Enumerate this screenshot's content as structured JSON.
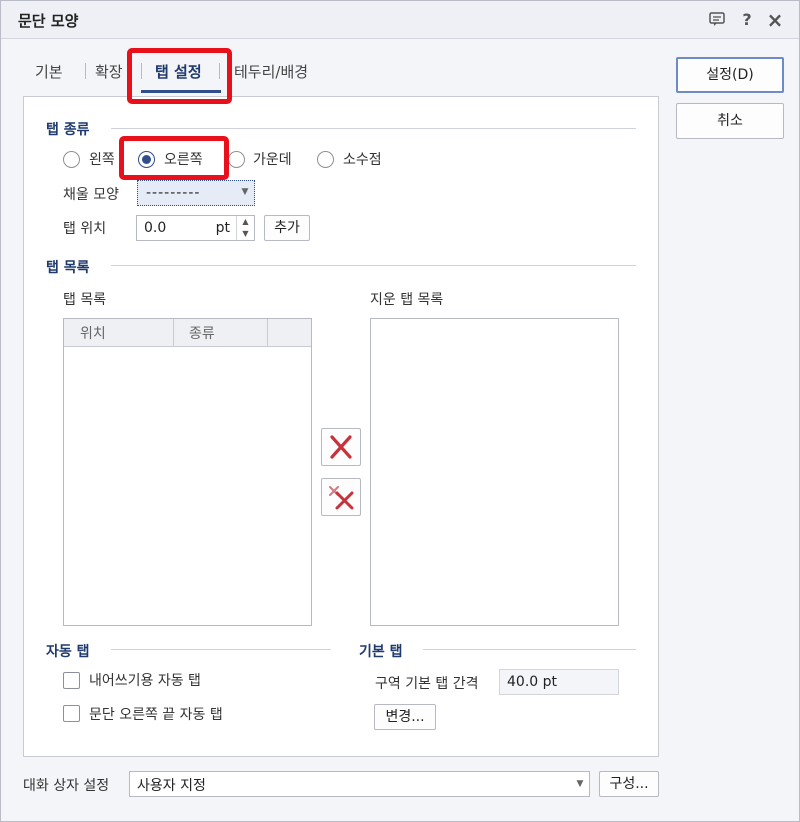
{
  "window": {
    "title": "문단 모양"
  },
  "titlebar": {
    "help_glyph": "?",
    "close_glyph": "×"
  },
  "tabs": [
    {
      "label": "기본"
    },
    {
      "label": "확장"
    },
    {
      "label": "탭 설정"
    },
    {
      "label": "테두리/배경"
    }
  ],
  "tab_type": {
    "section_title": "탭 종류",
    "options": [
      {
        "label": "왼쪽",
        "checked": false
      },
      {
        "label": "오른쪽",
        "checked": true
      },
      {
        "label": "가운데",
        "checked": false
      },
      {
        "label": "소수점",
        "checked": false
      }
    ],
    "fill_label": "채울 모양",
    "fill_value": "---------",
    "position_label": "탭 위치",
    "position_value": "0.0",
    "position_unit": "pt",
    "add_label": "추가"
  },
  "tab_list": {
    "section_title": "탭 목록",
    "list_label": "탭 목록",
    "columns": [
      "위치",
      "종류"
    ],
    "deleted_label": "지운 탭 목록"
  },
  "auto_tab": {
    "section_title": "자동 탭",
    "options": [
      {
        "label": "내어쓰기용 자동 탭",
        "checked": false
      },
      {
        "label": "문단 오른쪽 끝 자동 탭",
        "checked": false
      }
    ]
  },
  "default_tab": {
    "section_title": "기본 탭",
    "interval_label": "구역 기본 탭 간격",
    "interval_value": "40.0 pt",
    "change_label": "변경..."
  },
  "footer": {
    "dialog_setting_label": "대화 상자 설정",
    "dialog_setting_value": "사용자 지정",
    "configure_label": "구성..."
  },
  "actions": {
    "ok_label": "설정(D)",
    "cancel_label": "취소"
  },
  "colors": {
    "accent": "#2f4e8a",
    "highlight": "#e8101a",
    "delete_red": "#c8323a"
  }
}
